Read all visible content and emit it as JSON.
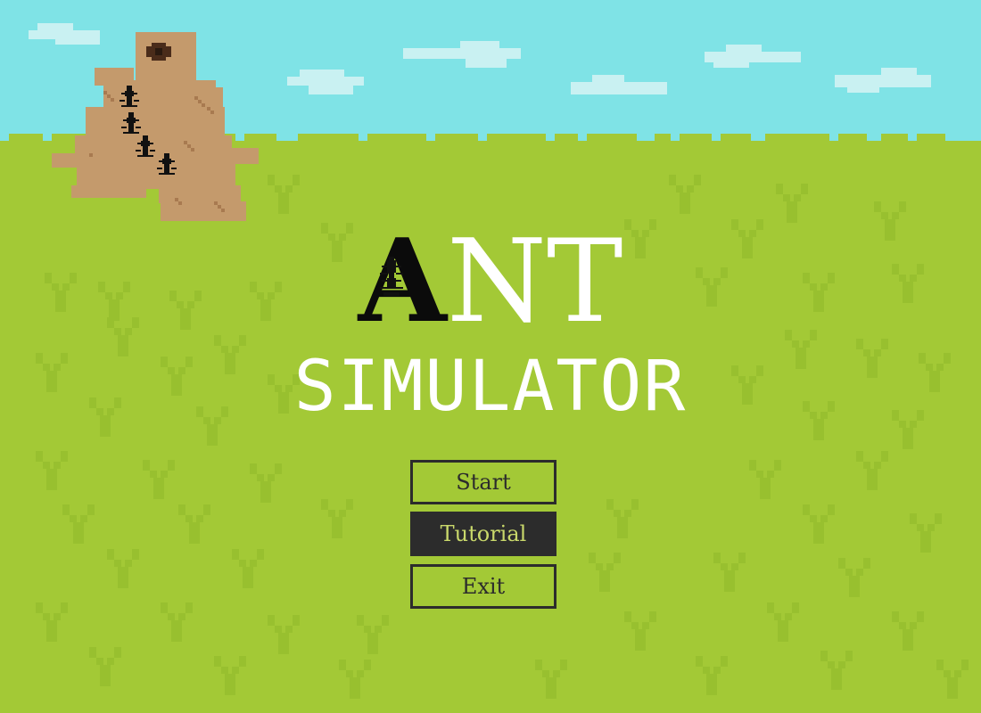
{
  "title": {
    "first_letter": "A",
    "rest": "NT",
    "subtitle": "SIMULATOR"
  },
  "menu": {
    "items": [
      {
        "label": "Start",
        "selected": false
      },
      {
        "label": "Tutorial",
        "selected": true
      },
      {
        "label": "Exit",
        "selected": false
      }
    ]
  },
  "colors": {
    "sky": "#7fe3e6",
    "grass": "#a3c936",
    "grass_sprout": "#98c02f",
    "mound": "#c49a6c",
    "button_border": "#2c2c2c",
    "selected_text": "#c9d86b"
  },
  "icons": [
    "ant-icon",
    "anthill-icon",
    "cloud-icon",
    "grass-sprout-icon"
  ]
}
